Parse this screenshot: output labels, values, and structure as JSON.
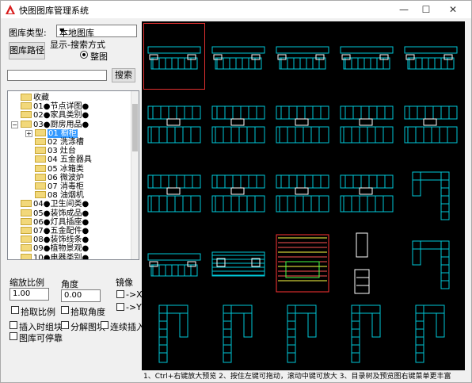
{
  "window": {
    "title": "快图图库管理系统",
    "min": "—",
    "max": "☐",
    "close": "✕"
  },
  "left": {
    "library_type_label": "图库类型:",
    "library_type_value": "本地图库",
    "library_path_button": "图库路径",
    "display_mode_label": "显示-搜索方式",
    "display_mode_option": "整图",
    "search_button": "搜索",
    "search_placeholder": ""
  },
  "tree": [
    {
      "label": "收藏",
      "level": 0,
      "toggle": ""
    },
    {
      "label": "01●节点详图●",
      "level": 0,
      "toggle": ""
    },
    {
      "label": "02●家具类别●",
      "level": 0,
      "toggle": ""
    },
    {
      "label": "03●厨房用品●",
      "level": 0,
      "toggle": "−"
    },
    {
      "label": "01 橱柜",
      "level": 1,
      "toggle": "+",
      "selected": true
    },
    {
      "label": "02 洗涤槽",
      "level": 1,
      "toggle": ""
    },
    {
      "label": "03 灶台",
      "level": 1,
      "toggle": ""
    },
    {
      "label": "04 五金器具",
      "level": 1,
      "toggle": ""
    },
    {
      "label": "05 冰箱类",
      "level": 1,
      "toggle": ""
    },
    {
      "label": "06 微波炉",
      "level": 1,
      "toggle": ""
    },
    {
      "label": "07 消毒柜",
      "level": 1,
      "toggle": ""
    },
    {
      "label": "08 油烟机",
      "level": 1,
      "toggle": ""
    },
    {
      "label": "04●卫生间类●",
      "level": 0,
      "toggle": ""
    },
    {
      "label": "05●装饰成品●",
      "level": 0,
      "toggle": ""
    },
    {
      "label": "06●灯具插座●",
      "level": 0,
      "toggle": ""
    },
    {
      "label": "07●五金配件●",
      "level": 0,
      "toggle": ""
    },
    {
      "label": "08●装饰线条●",
      "level": 0,
      "toggle": ""
    },
    {
      "label": "09●植物景观●",
      "level": 0,
      "toggle": ""
    },
    {
      "label": "10●电器类别●",
      "level": 0,
      "toggle": ""
    }
  ],
  "options": {
    "scale_label": "缩放比例",
    "scale_value": "1.00",
    "angle_label": "角度",
    "angle_value": "0.00",
    "mirror_label": "镜像",
    "mirror_x": "->X",
    "mirror_y": "->Y",
    "pick_scale": "拾取比例",
    "pick_angle": "拾取角度",
    "insert_on_click": "插入时组块",
    "explode_block": "分解图块",
    "continuous_insert": "连续插入",
    "library_dock": "图库可停靠"
  },
  "status_text": "1、Ctrl+右键放大预览   2、按住左键可拖动，滚动中键可放大   3、目录树及预览图右键菜单更丰富",
  "colors": {
    "accent": "#00c8d8",
    "selection": "#e03030",
    "tree_select": "#3399ff"
  },
  "thumbnails": [
    {
      "kind": "run"
    },
    {
      "kind": "run"
    },
    {
      "kind": "run"
    },
    {
      "kind": "run"
    },
    {
      "kind": "run"
    },
    {
      "kind": "elev"
    },
    {
      "kind": "elev"
    },
    {
      "kind": "elev"
    },
    {
      "kind": "elev"
    },
    {
      "kind": "elev"
    },
    {
      "kind": "elev"
    },
    {
      "kind": "elev"
    },
    {
      "kind": "elev"
    },
    {
      "kind": "elev"
    },
    {
      "kind": "L"
    },
    {
      "kind": "run"
    },
    {
      "kind": "plan"
    },
    {
      "kind": "color"
    },
    {
      "kind": "tall"
    },
    {
      "kind": "L"
    },
    {
      "kind": "col"
    },
    {
      "kind": "col"
    },
    {
      "kind": "col"
    },
    {
      "kind": "col"
    },
    {
      "kind": "col"
    }
  ]
}
